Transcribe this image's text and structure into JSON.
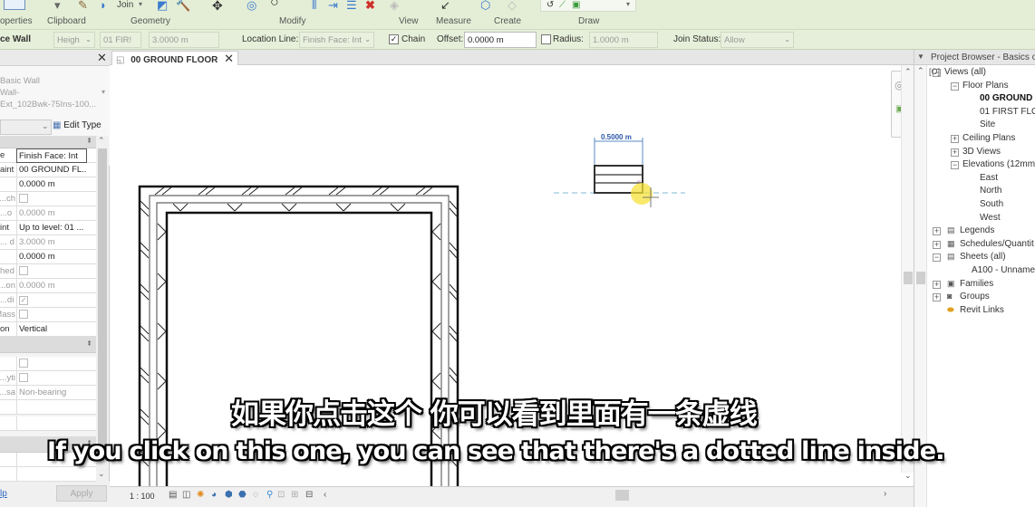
{
  "ribbon": {
    "panels": [
      {
        "label": "operties"
      },
      {
        "label": "Clipboard"
      },
      {
        "label": "Geometry"
      },
      {
        "label": "Modify"
      },
      {
        "label": "View"
      },
      {
        "label": "Measure"
      },
      {
        "label": "Create"
      },
      {
        "label": "Draw"
      }
    ],
    "join_label": "Join"
  },
  "options_bar": {
    "wall_type": "ce Wall",
    "height_mode": "Heigh",
    "level": "01 FIR!",
    "height_value": "3.0000 m",
    "location_line_label": "Location Line:",
    "location_line_value": "Finish Face: Int",
    "chain_label": "Chain",
    "chain_checked": true,
    "offset_label": "Offset:",
    "offset_value": "0.0000 m",
    "radius_label": "Radius:",
    "radius_checked": false,
    "radius_value": "1.0000 m",
    "join_status_label": "Join Status:",
    "join_status_value": "Allow"
  },
  "properties": {
    "type_line1": "Basic Wall",
    "type_line2": "Wall-",
    "type_line3": "Ext_102Bwk-75Ins-100...",
    "edit_type_label": "Edit Type",
    "rows": [
      {
        "key": "e",
        "value": "Finish Face: Int"
      },
      {
        "key": "aint",
        "value": "00 GROUND FL..."
      },
      {
        "key": "",
        "value": "0.0000 m"
      },
      {
        "key": "ch...",
        "value": ""
      },
      {
        "key": "o...",
        "value": "0.0000 m"
      },
      {
        "key": "int",
        "value": "Up to level: 01 ..."
      },
      {
        "key": "d ...",
        "value": "3.0000 m"
      },
      {
        "key": "",
        "value": "0.0000 m"
      },
      {
        "key": "hed",
        "value": ""
      },
      {
        "key": "on...",
        "value": "0.0000 m"
      },
      {
        "key": "di...",
        "value": ""
      },
      {
        "key": "Mass",
        "value": ""
      },
      {
        "key": "on",
        "value": "Vertical"
      },
      {
        "key": "",
        "value": ""
      },
      {
        "key": "yti...",
        "value": ""
      },
      {
        "key": "sa...",
        "value": "Non-bearing"
      }
    ],
    "help_label": "lp",
    "apply_label": "Apply"
  },
  "view": {
    "tab_label": "00 GROUND FLOOR",
    "dimension_label": "0.5000 m",
    "scale": "1 : 100"
  },
  "project_browser": {
    "title": "Project Browser - Basics of",
    "items": [
      {
        "label": "Views (all)"
      },
      {
        "label": "Floor Plans"
      },
      {
        "label": "00 GROUND"
      },
      {
        "label": "01 FIRST FLOC"
      },
      {
        "label": "Site"
      },
      {
        "label": "Ceiling Plans"
      },
      {
        "label": "3D Views"
      },
      {
        "label": "Elevations (12mm"
      },
      {
        "label": "East"
      },
      {
        "label": "North"
      },
      {
        "label": "South"
      },
      {
        "label": "West"
      },
      {
        "label": "Legends"
      },
      {
        "label": "Schedules/Quantit"
      },
      {
        "label": "Sheets (all)"
      },
      {
        "label": "A100 - Unnamed"
      },
      {
        "label": "Families"
      },
      {
        "label": "Groups"
      },
      {
        "label": "Revit Links"
      }
    ]
  },
  "subtitles": {
    "chinese": "如果你点击这个 你可以看到里面有一条虚线",
    "english": "If you click on this one, you can see that there's a dotted line inside."
  }
}
